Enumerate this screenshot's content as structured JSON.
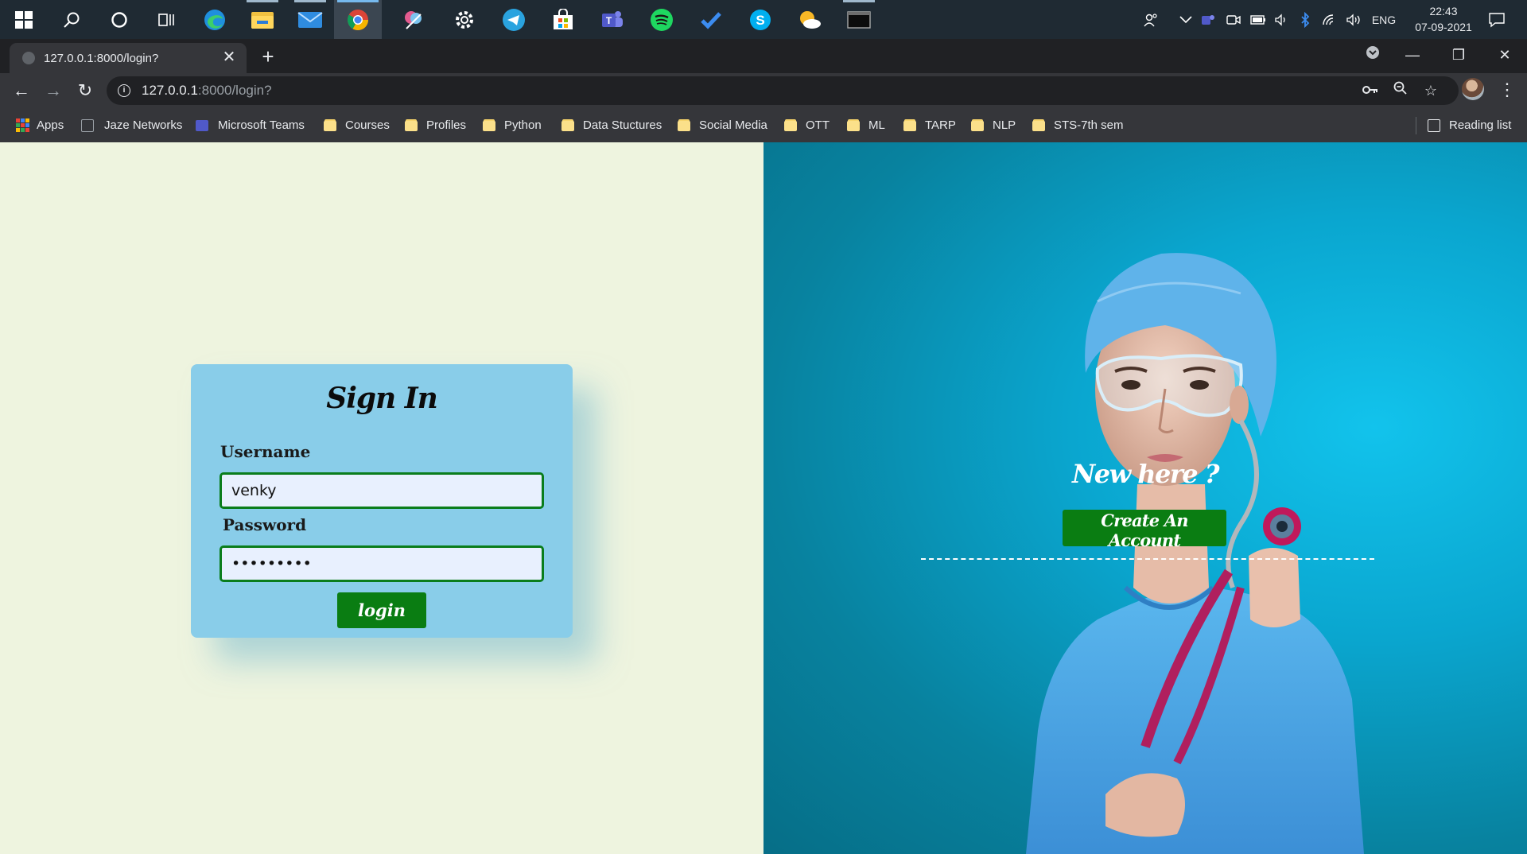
{
  "taskbar": {
    "icons": [
      "windows-start-icon",
      "search-icon",
      "cortana-icon",
      "task-view-icon",
      "edge-icon",
      "file-explorer-icon",
      "mail-icon",
      "chrome-icon",
      "snip-icon",
      "settings-icon",
      "telegram-icon",
      "store-icon",
      "teams-icon",
      "spotify-icon",
      "todo-icon",
      "skype-icon",
      "weather-icon",
      "terminal-icon"
    ],
    "tray": {
      "language": "ENG",
      "time": "22:43",
      "date": "07-09-2021"
    }
  },
  "browser": {
    "tab_title": "127.0.0.1:8000/login?",
    "url_host": "127.0.0.1",
    "url_rest": ":8000/login?",
    "bookmarks": [
      "Apps",
      "Jaze Networks",
      "Microsoft Teams",
      "Courses",
      "Profiles",
      "Python",
      "Data Stuctures",
      "Social Media",
      "OTT",
      "ML",
      "TARP",
      "NLP",
      "STS-7th sem"
    ],
    "reading_list": "Reading list"
  },
  "login": {
    "title": "Sign In",
    "username_label": "Username",
    "username_value": "venky",
    "password_label": "Password",
    "password_value": "•••••••••",
    "login_button": "login"
  },
  "signup": {
    "prompt": "New here ?",
    "button": "Create An Account"
  },
  "colors": {
    "left_background": "#eef4df",
    "card_background": "#89cde9",
    "button_green": "#0a7d12",
    "right_background": "#0aa6cf"
  }
}
